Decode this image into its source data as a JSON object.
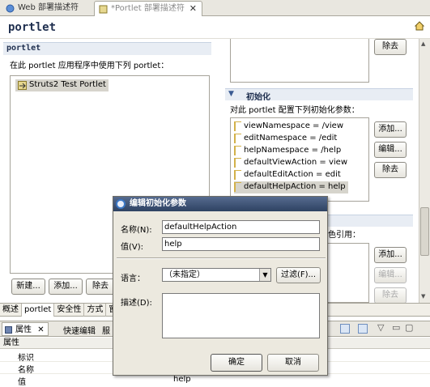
{
  "editor_tabs": [
    {
      "label": "Web 部署描述符",
      "active": false
    },
    {
      "label": "*Portlet 部署描述符",
      "active": true
    }
  ],
  "page_title": "portlet",
  "portlet_section": {
    "title": "portlet",
    "description": "在此 portlet 应用程序中使用下列 portlet：",
    "items": [
      "Struts2 Test Portlet"
    ],
    "buttons": [
      "新建...",
      "添加...",
      "除去"
    ]
  },
  "top_right_button": "除去",
  "init_section": {
    "title": "初始化",
    "description": "对此 portlet 配置下列初始化参数：",
    "params": [
      "viewNamespace = /view",
      "editNamespace = /edit",
      "helpNamespace = /help",
      "defaultViewAction = view",
      "defaultEditAction = edit",
      "defaultHelpAction = help"
    ],
    "buttons": [
      "添加...",
      "编辑...",
      "除去"
    ]
  },
  "role_section": {
    "description_tail": "色引用：",
    "buttons": [
      "添加...",
      "编辑...",
      "除去"
    ]
  },
  "bottom_tabs": [
    "概述",
    "portlet",
    "安全性",
    "方式",
    "窗"
  ],
  "properties_view": {
    "tabs": [
      "属性",
      "快速编辑",
      "服"
    ],
    "column_header": "属性",
    "rows": [
      "标识",
      "名称",
      "值"
    ],
    "value_partial": "help"
  },
  "dialog": {
    "title": "编辑初始化参数",
    "name_label": "名称(N):",
    "name_value": "defaultHelpAction",
    "value_label": "值(V):",
    "value_value": "help",
    "language_label": "语言：",
    "language_value": "（未指定）",
    "filter_button": "过滤(F)...",
    "description_label": "描述(D):",
    "description_value": "",
    "ok_button": "确定",
    "cancel_button": "取消"
  }
}
